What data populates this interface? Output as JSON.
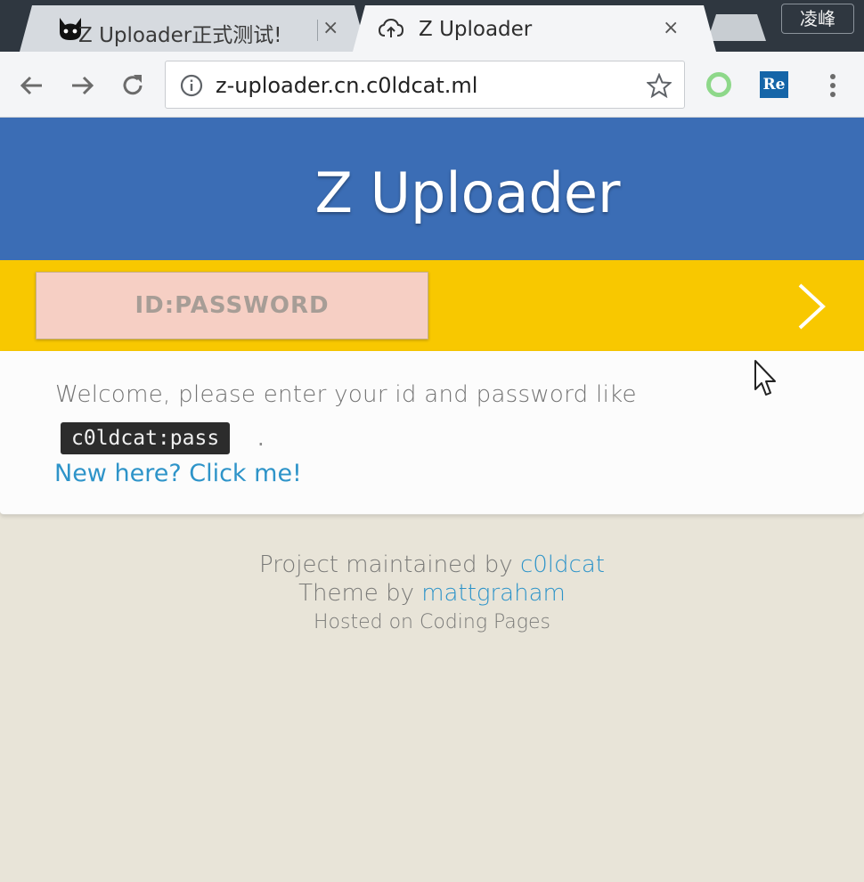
{
  "browser": {
    "tabs": [
      {
        "title": "Z Uploader正式测试!",
        "close": "×",
        "favicon": "cat-icon",
        "active": false
      },
      {
        "title": "Z Uploader",
        "close": "×",
        "favicon": "cloud-upload-icon",
        "active": true
      }
    ],
    "profile_name": "凌峰",
    "address_bar": {
      "url": "z-uploader.cn.c0ldcat.ml"
    },
    "extensions": [
      {
        "name": "green-ring-extension-icon"
      },
      {
        "name": "re-extension-icon",
        "label": "Re"
      }
    ]
  },
  "page": {
    "site_title": "Z Uploader",
    "login": {
      "placeholder": "ID:PASSWORD",
      "submit_icon": "chevron-right-icon"
    },
    "welcome": {
      "text": "Welcome, please enter your id and password like",
      "example": "c0ldcat:pass",
      "period": ".",
      "new_here_link": "New here? Click me!"
    },
    "footer": {
      "maintained_prefix": "Project maintained by",
      "maintainer": "c0ldcat",
      "theme_prefix": "Theme by",
      "theme_author": "mattgraham",
      "hosted": "Hosted on Coding Pages"
    }
  },
  "colors": {
    "header_blue": "#3b6db5",
    "login_yellow": "#f8c800",
    "input_pink": "#f6cfc4",
    "link_blue": "#2e94c9",
    "page_bg": "#e8e4d8"
  }
}
